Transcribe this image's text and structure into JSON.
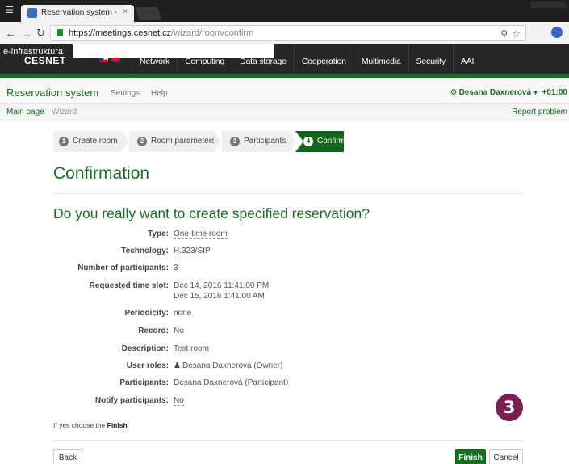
{
  "browser": {
    "tab_title": "Reservation system - Wi",
    "tab_close": "×",
    "url_host": "https://meetings.cesnet.cz",
    "url_path": "/wizard/room/confirm"
  },
  "site": {
    "brand_line1": "e-infrastruktura",
    "brand_line2": "CESNET",
    "nav": [
      "Network",
      "Computing",
      "Data storage",
      "Cooperation",
      "Multimedia",
      "Security",
      "AAI"
    ]
  },
  "app": {
    "title": "Reservation system",
    "links": [
      "Settings",
      "Help"
    ],
    "user_name": "Desana Daxnerová",
    "timezone": "+01:00",
    "breadcrumb": [
      "Main page",
      "Wizard"
    ],
    "breadcrumb_sep": "/",
    "report_problem": "Report problem"
  },
  "wizard": {
    "steps": [
      {
        "num": "1",
        "label": "Create room"
      },
      {
        "num": "2",
        "label": "Room parameters"
      },
      {
        "num": "3",
        "label": "Participants"
      },
      {
        "num": "4",
        "label": "Confirm"
      }
    ],
    "active_step": 4
  },
  "content": {
    "title": "Confirmation",
    "question": "Do you really want to create specified reservation?",
    "details": [
      {
        "label": "Type:",
        "value": "One-time room"
      },
      {
        "label": "Technology:",
        "value": "H.323/SIP"
      },
      {
        "label": "Number of participants:",
        "value": "3"
      },
      {
        "label": "Requested time slot:",
        "value": "Dec 14, 2016 11:41:00 PM",
        "value2": "Dec 15, 2016 1:41:00 AM"
      },
      {
        "label": "Periodicity:",
        "value": "none"
      },
      {
        "label": "Record:",
        "value": "No"
      },
      {
        "label": "Description:",
        "value": "Test room"
      },
      {
        "label": "User roles:",
        "value": "Desana Daxnerová (Owner)"
      },
      {
        "label": "Participants:",
        "value": "Desana Daxnerová (Participant)"
      },
      {
        "label": "Notify participants:",
        "value": "No"
      }
    ],
    "hint_prefix": "If yes choose the ",
    "hint_bold": "Finish",
    "hint_suffix": "."
  },
  "annotation_badge": "3",
  "buttons": {
    "back": "Back",
    "finish": "Finish",
    "cancel": "Cancel"
  },
  "colors": {
    "brand_green": "#1e6b27",
    "active_step": "#15651e",
    "badge": "#7a1e4e"
  }
}
